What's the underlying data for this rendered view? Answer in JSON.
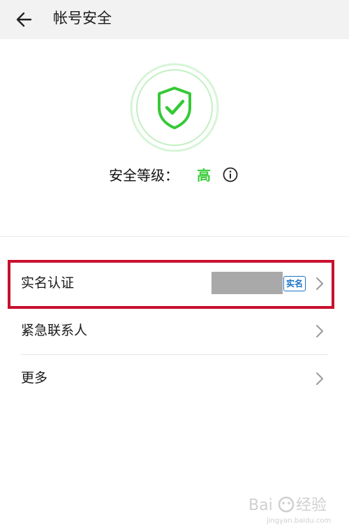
{
  "header": {
    "title": "帐号安全",
    "back_icon": "arrow-left-icon"
  },
  "security": {
    "shield_icon": "shield-check-icon",
    "level_label": "安全等级：",
    "level_value": "高",
    "info_icon": "info-icon",
    "shield_color": "#36c936",
    "level_color": "#3dcc3d"
  },
  "list": {
    "items": [
      {
        "label": "实名认证",
        "badge": "实名",
        "chevron_icon": "chevron-right-icon"
      },
      {
        "label": "紧急联系人",
        "chevron_icon": "chevron-right-icon"
      },
      {
        "label": "更多",
        "chevron_icon": "chevron-right-icon"
      }
    ]
  },
  "highlight_color": "#c8102e",
  "watermark": {
    "text": "Bai 经验",
    "subtext": "jingyan.baidu.com"
  }
}
